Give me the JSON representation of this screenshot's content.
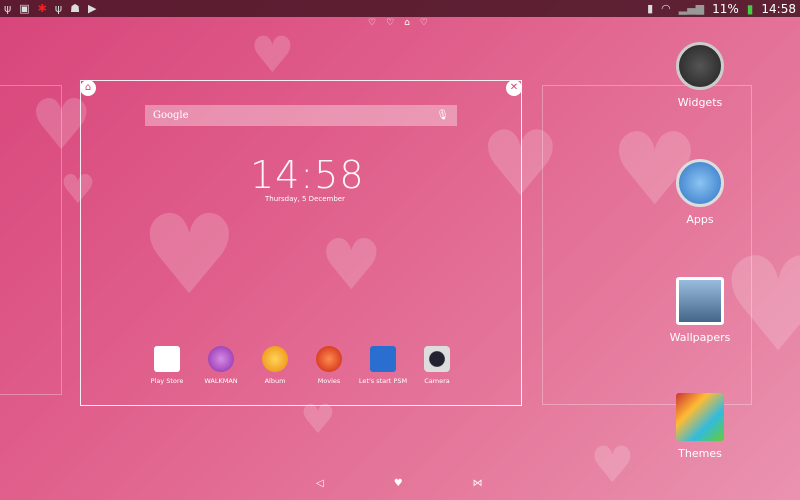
{
  "status_bar": {
    "battery": "11%",
    "time": "14:58"
  },
  "search": {
    "label": "Google"
  },
  "clock": {
    "time": "14:58",
    "date": "Thursday, 5 December"
  },
  "dock_apps": [
    {
      "label": "Play Store"
    },
    {
      "label": "WALKMAN"
    },
    {
      "label": "Album"
    },
    {
      "label": "Movies"
    },
    {
      "label": "Let's start PSM"
    },
    {
      "label": "Camera"
    }
  ],
  "side_menu": [
    {
      "label": "Widgets"
    },
    {
      "label": "Apps"
    },
    {
      "label": "Wallpapers"
    },
    {
      "label": "Themes"
    }
  ]
}
